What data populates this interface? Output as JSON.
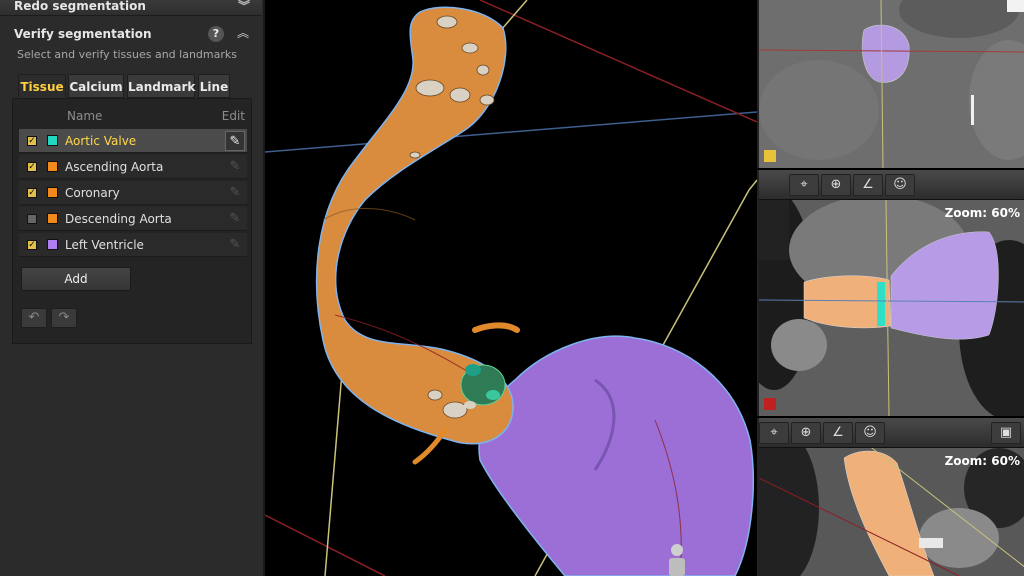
{
  "panel": {
    "redo_title": "Redo segmentation",
    "verify_title": "Verify segmentation",
    "help_glyph": "?",
    "subtitle": "Select and verify tissues and landmarks",
    "tabs": [
      {
        "label": "Tissue",
        "active": true
      },
      {
        "label": "Calcium",
        "active": false
      },
      {
        "label": "Landmark",
        "active": false
      },
      {
        "label": "Line",
        "active": false
      }
    ],
    "list_headers": {
      "name": "Name",
      "edit": "Edit"
    },
    "tissues": [
      {
        "name": "Aortic Valve",
        "checked": true,
        "color": "#22d6c2",
        "selected": true
      },
      {
        "name": "Ascending Aorta",
        "checked": true,
        "color": "#f08a1c",
        "selected": false
      },
      {
        "name": "Coronary",
        "checked": true,
        "color": "#f08a1c",
        "selected": false
      },
      {
        "name": "Descending Aorta",
        "checked": false,
        "color": "#f08a1c",
        "selected": false
      },
      {
        "name": "Left Ventricle",
        "checked": true,
        "color": "#b07ef0",
        "selected": false
      }
    ],
    "add_label": "Add",
    "undo_icon": "undo-icon",
    "redo_icon": "redo-icon"
  },
  "views": {
    "coronal_zoom": "Zoom: 60%",
    "sagittal_zoom": "Zoom: 60%"
  },
  "colors": {
    "aorta": "#d98b3e",
    "ventricle": "#9b6fd6",
    "accent": "#ffcf3f"
  }
}
